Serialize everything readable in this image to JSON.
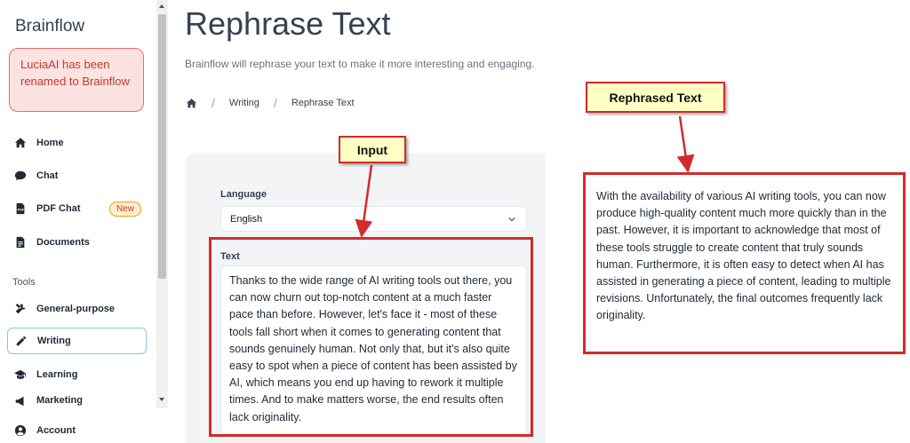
{
  "sidebar": {
    "brand": "Brainflow",
    "notice": "LuciaAI has been renamed to Brainflow",
    "items": [
      {
        "label": "Home",
        "icon": "home-icon"
      },
      {
        "label": "Chat",
        "icon": "chat-icon"
      },
      {
        "label": "PDF Chat",
        "icon": "pdf-icon",
        "badge": "New"
      },
      {
        "label": "Documents",
        "icon": "document-icon"
      }
    ],
    "tools_label": "Tools",
    "tools": [
      {
        "label": "General-purpose",
        "icon": "tools-icon"
      },
      {
        "label": "Writing",
        "icon": "pencil-icon",
        "active": true
      },
      {
        "label": "Learning",
        "icon": "graduation-cap-icon"
      },
      {
        "label": "Marketing",
        "icon": "megaphone-icon"
      }
    ],
    "account": {
      "label": "Account",
      "icon": "user-icon"
    }
  },
  "main": {
    "title": "Rephrase Text",
    "subtitle": "Brainflow will rephrase your text to make it more interesting and engaging.",
    "breadcrumb": [
      "Writing",
      "Rephrase Text"
    ],
    "language_label": "Language",
    "language_value": "English",
    "text_label": "Text",
    "input_text": "Thanks to the wide range of AI writing tools out there, you can now churn out top-notch content at a much faster pace than before. However, let's face it - most of these tools fall short when it comes to generating content that sounds genuinely human. Not only that, but it's also quite easy to spot when a piece of content has been assisted by AI, which means you end up having to rework it multiple times. And to make matters worse, the end results often lack originality.",
    "output_text": "With the availability of various AI writing tools, you can now produce high-quality content much more quickly than in the past. However, it is important to acknowledge that most of these tools struggle to create content that truly sounds human. Furthermore, it is often easy to detect when AI has assisted in generating a piece of content, leading to multiple revisions. Unfortunately, the final outcomes frequently lack originality."
  },
  "annotations": {
    "input_callout": "Input",
    "output_callout": "Rephrased Text"
  },
  "colors": {
    "annotation_red": "#d42a2a",
    "callout_fill": "#ffffc4",
    "notice_bg": "#fde2e2",
    "active_border": "#7dc7e8"
  }
}
